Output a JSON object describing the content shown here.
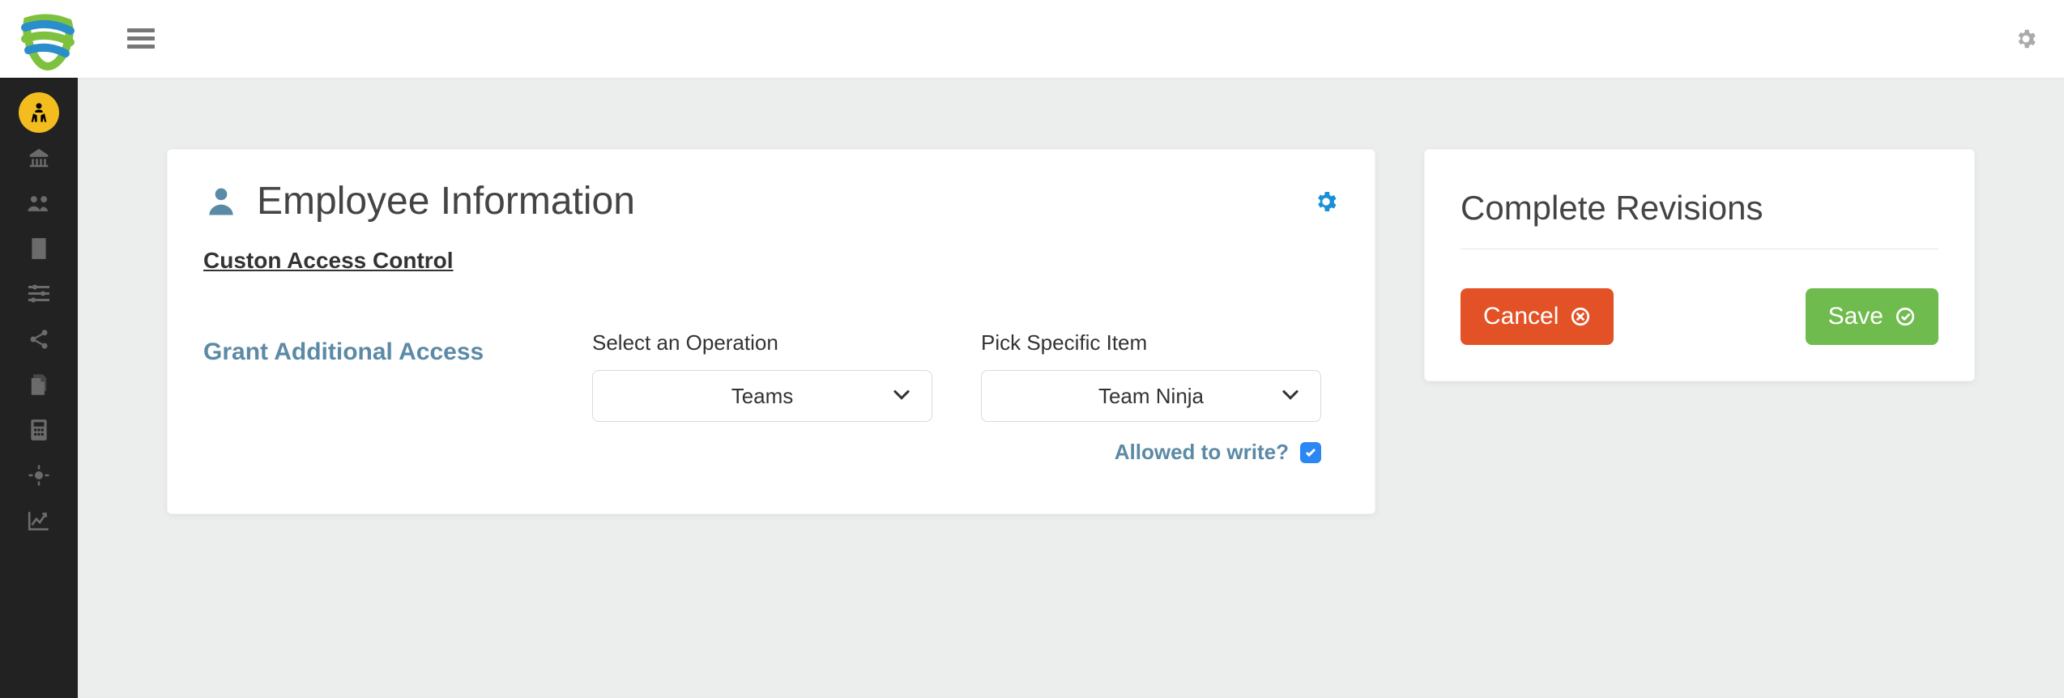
{
  "header": {
    "logo": "tooth-logo"
  },
  "sidebar": {
    "items": [
      {
        "id": "person",
        "active": true
      },
      {
        "id": "bank",
        "active": false
      },
      {
        "id": "users",
        "active": false
      },
      {
        "id": "building",
        "active": false
      },
      {
        "id": "sliders",
        "active": false
      },
      {
        "id": "share",
        "active": false
      },
      {
        "id": "copy",
        "active": false
      },
      {
        "id": "calc",
        "active": false
      },
      {
        "id": "target",
        "active": false
      },
      {
        "id": "chart",
        "active": false
      }
    ]
  },
  "card_main": {
    "title": "Employee Information",
    "subhead": "Custon Access Control",
    "grant_label": "Grant Additional Access",
    "operation_label": "Select an Operation",
    "operation_value": "Teams",
    "item_label": "Pick Specific Item",
    "item_value": "Team Ninja",
    "allow_label": "Allowed to write?",
    "allow_checked": true
  },
  "card_side": {
    "title": "Complete Revisions",
    "cancel_label": "Cancel",
    "save_label": "Save"
  }
}
